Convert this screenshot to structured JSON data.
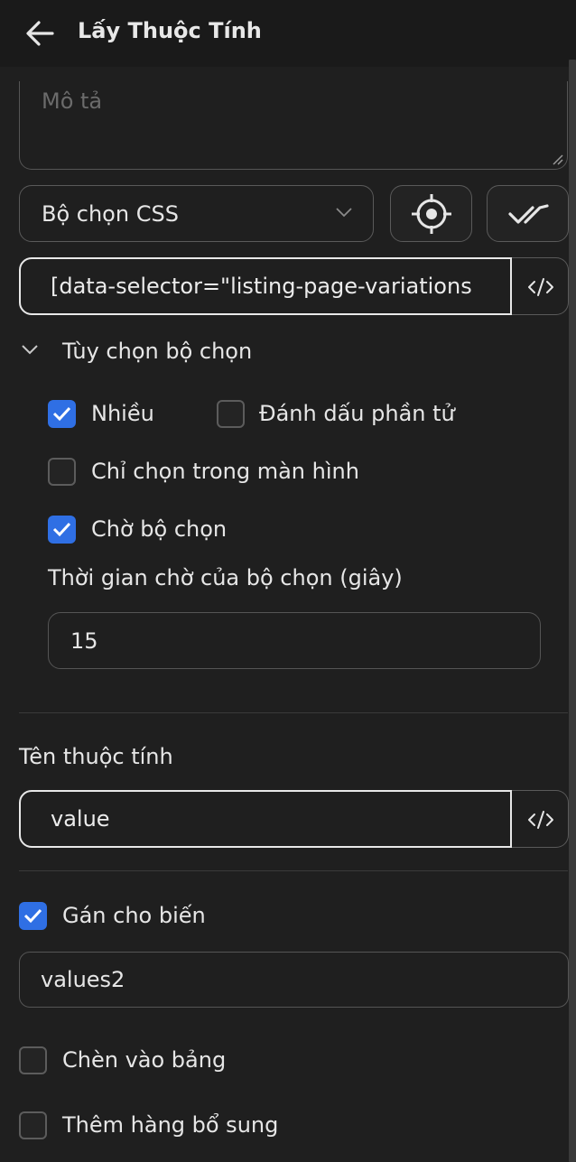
{
  "header": {
    "title": "Lấy Thuộc Tính",
    "back_icon": "arrow-left-icon"
  },
  "description": {
    "placeholder": "Mô tả"
  },
  "selector_type": {
    "value": "Bộ chọn CSS"
  },
  "selector": {
    "value": "[data-selector=\"listing-page-variations",
    "code_icon": "code-icon"
  },
  "selector_options": {
    "label": "Tùy chọn bộ chọn",
    "multiple": {
      "label": "Nhiều",
      "checked": true
    },
    "mark_element": {
      "label": "Đánh dấu phần tử",
      "checked": false
    },
    "only_visible": {
      "label": "Chỉ chọn trong màn hình",
      "checked": false
    },
    "wait_selector": {
      "label": "Chờ bộ chọn",
      "checked": true
    },
    "timeout_label": "Thời gian chờ của bộ chọn (giây)",
    "timeout_value": "15"
  },
  "attribute": {
    "label": "Tên thuộc tính",
    "value": "value"
  },
  "assign_variable": {
    "label": "Gán cho biến",
    "checked": true,
    "value": "values2"
  },
  "insert_table": {
    "label": "Chèn vào bảng",
    "checked": false
  },
  "extra_row": {
    "label": "Thêm hàng bổ sung",
    "checked": false
  },
  "colors": {
    "accent": "#2f6fe4",
    "background": "#1f1f1f"
  }
}
